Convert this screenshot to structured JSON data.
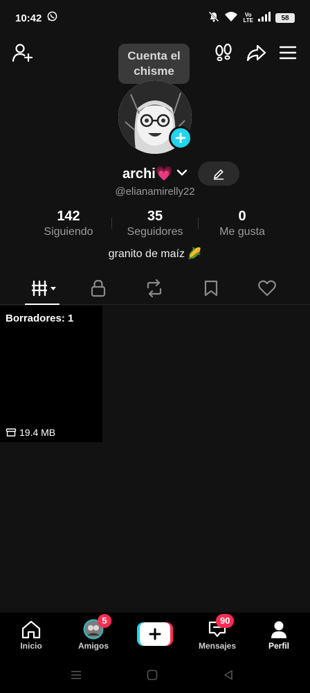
{
  "status_bar": {
    "time": "10:42",
    "volte_top": "Vo",
    "volte_bottom": "LTE",
    "battery": "58",
    "icons": [
      "whatsapp-icon",
      "mute-icon",
      "wifi-icon",
      "signal-icon",
      "battery-icon"
    ]
  },
  "header": {
    "tooltip_line1": "Cuenta el",
    "tooltip_line2": "chisme",
    "icons": [
      "add-user-icon",
      "footprints-icon",
      "share-icon",
      "menu-icon"
    ]
  },
  "profile": {
    "name": "archi💗",
    "handle": "@elianamirelly22",
    "bio": "granito de maíz 🌽"
  },
  "stats": [
    {
      "value": "142",
      "label": "Siguiendo"
    },
    {
      "value": "35",
      "label": "Seguidores"
    },
    {
      "value": "0",
      "label": "Me gusta"
    }
  ],
  "tabs": [
    "videos-grid-icon",
    "lock-icon",
    "repost-icon",
    "bookmark-icon",
    "heart-icon"
  ],
  "draft": {
    "label": "Borradores: 1",
    "size": "19.4 MB"
  },
  "bottom_nav": {
    "home": "Inicio",
    "friends": "Amigos",
    "friends_badge": "5",
    "messages": "Mensajes",
    "messages_badge": "90",
    "profile": "Perfil"
  },
  "colors": {
    "background": "#121212",
    "accent_cyan": "#20d5ec",
    "accent_red": "#fe2c55"
  }
}
